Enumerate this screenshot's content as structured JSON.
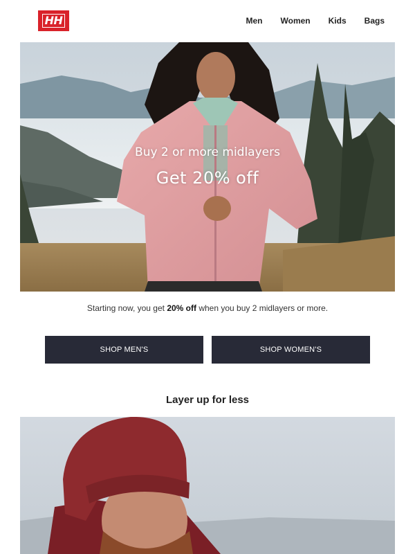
{
  "brand": {
    "logo_text": "HH",
    "color": "#d9222a"
  },
  "nav": {
    "items": [
      "Men",
      "Women",
      "Kids",
      "Bags"
    ]
  },
  "hero": {
    "subtitle": "Buy 2 or more midlayers",
    "headline": "Get 20% off"
  },
  "intro": {
    "prefix": "Starting now, you get ",
    "bold": "20% off",
    "suffix": " when you buy 2 midlayers or more."
  },
  "buttons": {
    "men_label": "SHOP MEN'S",
    "women_label": "SHOP WOMEN'S",
    "color": "#282a37"
  },
  "section": {
    "title": "Layer up for less"
  },
  "icons": {
    "logo": "helly-hansen-logo"
  }
}
